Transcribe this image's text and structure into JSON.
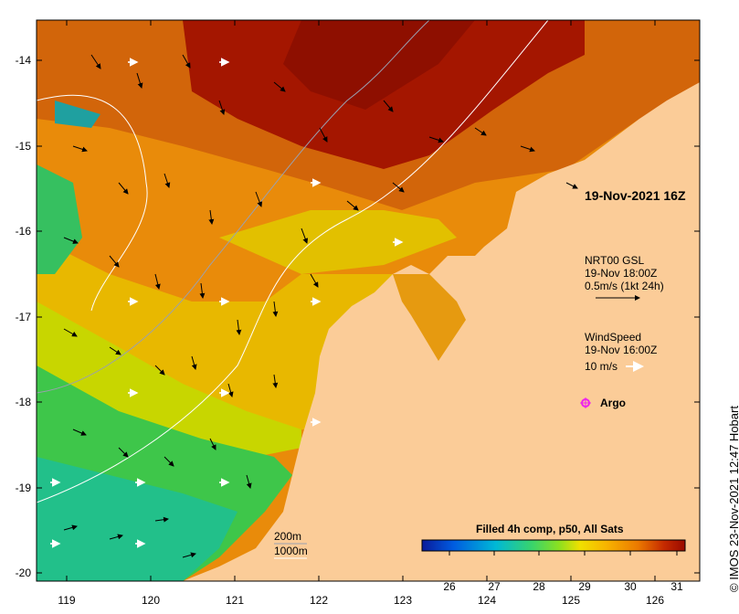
{
  "map": {
    "valid_time": "19-Nov-2021 16Z",
    "colorbar_title": "Filled 4h comp, p50, All Sats",
    "colorbar_ticks": [
      "26",
      "27",
      "28",
      "29",
      "30",
      "31"
    ],
    "colorbar_colors": [
      "#0a1a9a",
      "#005ce0",
      "#00b8d6",
      "#3ad46a",
      "#8be020",
      "#f0e000",
      "#f7b400",
      "#ec7a00",
      "#c52a00",
      "#9a0a00"
    ],
    "y_ticks": [
      "-14",
      "-15",
      "-16",
      "-17",
      "-18",
      "-19",
      "-20"
    ],
    "x_ticks": [
      "119",
      "120",
      "121",
      "122",
      "123",
      "124",
      "125",
      "126"
    ],
    "current_legend": {
      "source": "NRT00 GSL",
      "time": "19-Nov 18:00Z",
      "scale": "0.5m/s (1kt 24h)"
    },
    "wind_legend": {
      "label": "WindSpeed",
      "time": "19-Nov 16:00Z",
      "scale": "10 m/s"
    },
    "argo_label": "Argo",
    "bathy_legend": [
      "200m",
      "1000m"
    ],
    "credit": "© IMOS 23-Nov-2021 12:47 Hobart",
    "colors": {
      "land": "#fbcc98",
      "sst_warm": "#e98b0a",
      "sst_hot": "#a41600",
      "sst_cool": "#1fc080",
      "argo": "#ee22ee"
    }
  }
}
